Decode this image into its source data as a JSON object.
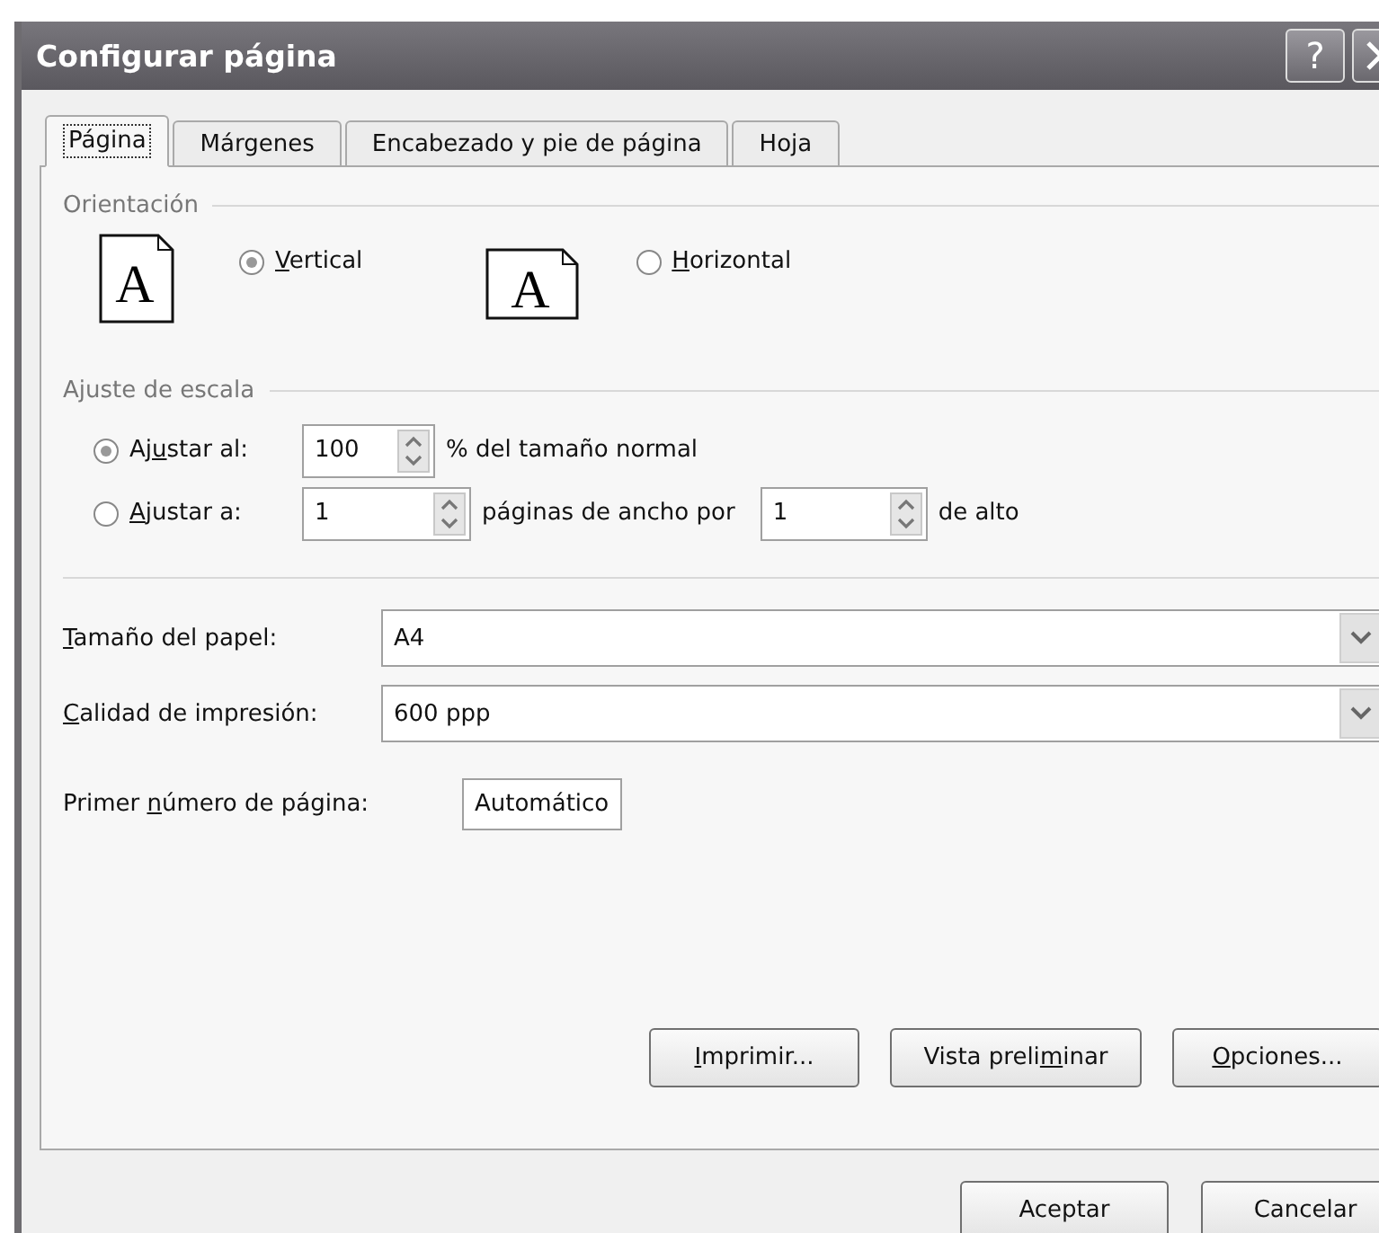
{
  "window": {
    "title": "Configurar página",
    "help": "?"
  },
  "tabs": [
    {
      "label": "Página",
      "selected": true
    },
    {
      "label": "Márgenes",
      "selected": false
    },
    {
      "label": "Encabezado y pie de página",
      "selected": false
    },
    {
      "label": "Hoja",
      "selected": false
    }
  ],
  "orientation": {
    "heading": "Orientación",
    "options": [
      {
        "kind": "portrait",
        "selected": true,
        "label": {
          "key": "V",
          "post": "ertical"
        },
        "glyph": "A"
      },
      {
        "kind": "landscape",
        "selected": false,
        "label": {
          "key": "H",
          "post": "orizontal"
        },
        "glyph": "A"
      }
    ]
  },
  "scaling": {
    "heading": "Ajuste de escala",
    "rows": [
      {
        "kind": "percent",
        "selected": true,
        "label": {
          "pre": "Aj",
          "key": "u",
          "post": "star al:"
        },
        "value": "100",
        "suffix": "% del tamaño normal"
      },
      {
        "kind": "fit",
        "selected": false,
        "label": {
          "key": "A",
          "post": "justar a:"
        },
        "value": "1",
        "suffix": "páginas de ancho por",
        "value_2": "1",
        "suffix_2": "de alto"
      }
    ]
  },
  "paper_size": {
    "label": {
      "key": "T",
      "post": "amaño del papel:"
    },
    "value": "A4"
  },
  "print_quality": {
    "label": {
      "key": "C",
      "post": "alidad de impresión:"
    },
    "value": "600 ppp"
  },
  "first_page_number": {
    "label": {
      "pre": "Primer ",
      "key": "n",
      "post": "úmero de página:"
    },
    "value": "Automático"
  },
  "panel_buttons": [
    {
      "label": {
        "key": "I",
        "post": "mprimir..."
      }
    },
    {
      "label": {
        "pre": "Vista preli",
        "key": "m",
        "post": "inar"
      }
    },
    {
      "label": {
        "key": "O",
        "post": "pciones..."
      }
    }
  ],
  "dialog_buttons": [
    {
      "label": "Aceptar"
    },
    {
      "label": "Cancelar"
    }
  ]
}
